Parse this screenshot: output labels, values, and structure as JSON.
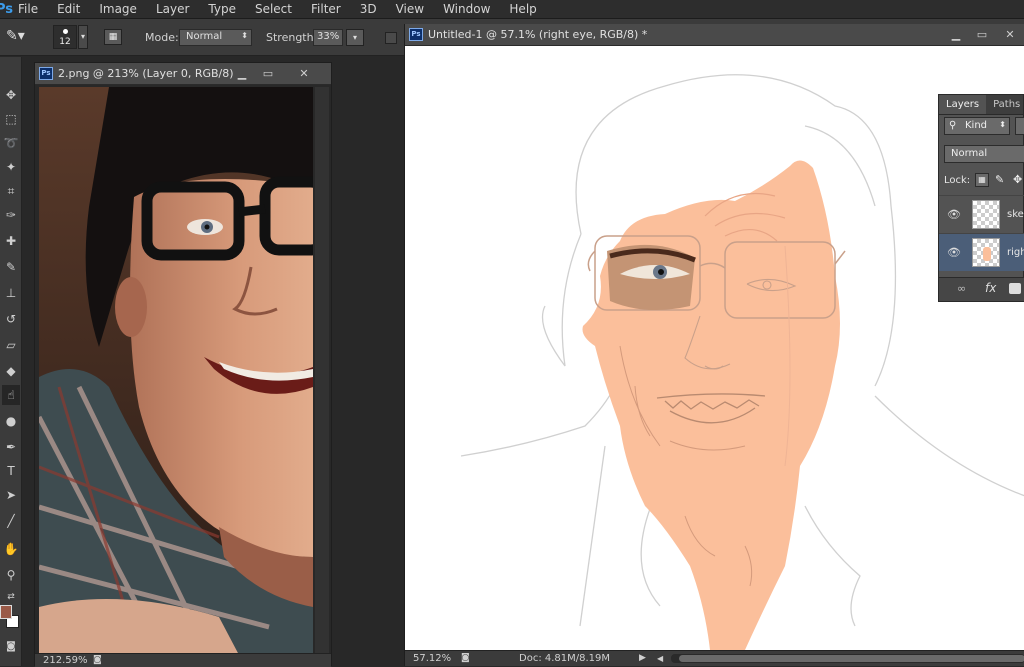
{
  "app": {
    "logo": "Ps"
  },
  "menu": [
    "File",
    "Edit",
    "Image",
    "Layer",
    "Type",
    "Select",
    "Filter",
    "3D",
    "View",
    "Window",
    "Help"
  ],
  "options": {
    "brush_size": "12",
    "mode_label": "Mode:",
    "mode_value": "Normal",
    "strength_label": "Strength:",
    "strength_value": "33%"
  },
  "left_doc": {
    "title": "2.png @ 213% (Layer 0, RGB/8)",
    "zoom": "212.59%"
  },
  "right_doc": {
    "title": "Untitled-1 @ 57.1% (right eye, RGB/8) *",
    "zoom": "57.12%",
    "doc_info": "Doc: 4.81M/8.19M"
  },
  "layers_panel": {
    "tabs": [
      "Layers",
      "Paths"
    ],
    "filter_kind": "Kind",
    "blend_mode": "Normal",
    "lock_label": "Lock:",
    "layers": [
      {
        "name": "sket",
        "selected": false
      },
      {
        "name": "righ",
        "selected": true
      }
    ]
  },
  "colors": {
    "skin": "#fbbf9b",
    "foreground": "#9a5a48",
    "background": "#ffffff",
    "accent": "#3c9ded"
  }
}
